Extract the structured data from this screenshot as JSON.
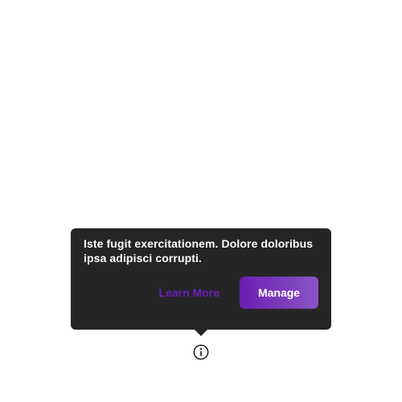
{
  "tooltip": {
    "text": "Iste fugit exercitationem. Dolore doloribus ipsa adipisci corrupti.",
    "learn_more_label": "Learn More",
    "manage_label": "Manage"
  },
  "info_trigger": {
    "icon": "info-circle-icon"
  },
  "colors": {
    "tooltip_background": "#262526",
    "tooltip_text": "#ffffff",
    "link_accent": "#6a20b8",
    "button_gradient_start": "#6a1fb0",
    "button_gradient_end": "#8a54c7"
  }
}
